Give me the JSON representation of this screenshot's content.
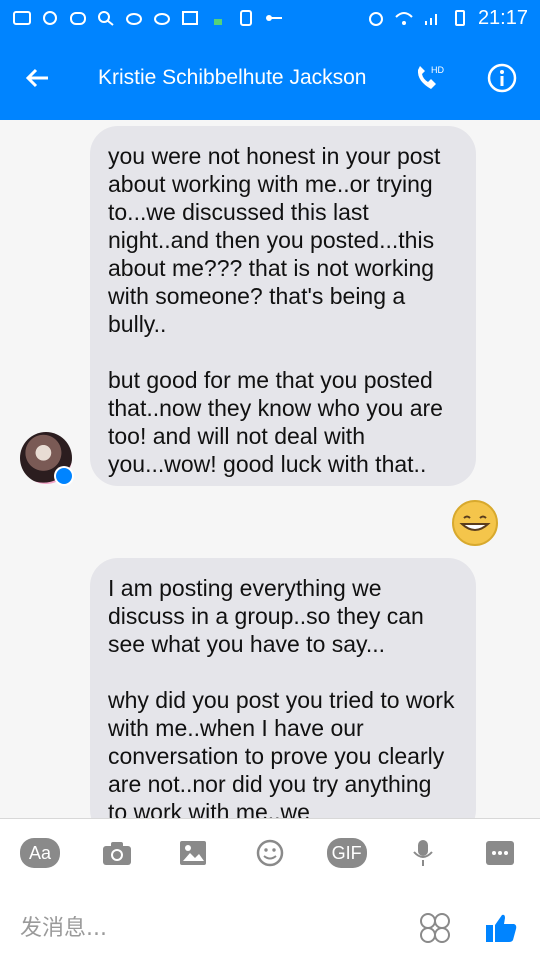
{
  "status_bar": {
    "time": "21:17"
  },
  "header": {
    "title": "Kristie Schibbelhute Jackson",
    "hd_label": "HD"
  },
  "messages": [
    {
      "text": "you were not honest in your post about working with me..or trying to...we discussed this last night..and then you posted...this about me??? that is not working with someone? that's being a bully..\n\nbut good for me that you posted that..now they know who you are too! and will not deal with you...wow! good luck with that.."
    },
    {
      "text": "I am posting everything we discuss in a group..so they can see what you have to say...\n\nwhy did you post you tried to work with me..when I have our conversation to prove you clearly are not..nor did you try anything to work with me..we"
    }
  ],
  "composer": {
    "placeholder": "发消息...",
    "aa_label": "Aa",
    "gif_label": "GIF"
  },
  "colors": {
    "brand": "#0084ff",
    "bubble": "#e5e5ea",
    "icon_gray": "#8a8a8a"
  },
  "icons": [
    "back-arrow-icon",
    "phone-hd-icon",
    "info-icon",
    "camera-icon",
    "image-icon",
    "emoji-icon",
    "microphone-icon",
    "more-icon",
    "sticker-icon",
    "thumbs-up-icon"
  ]
}
